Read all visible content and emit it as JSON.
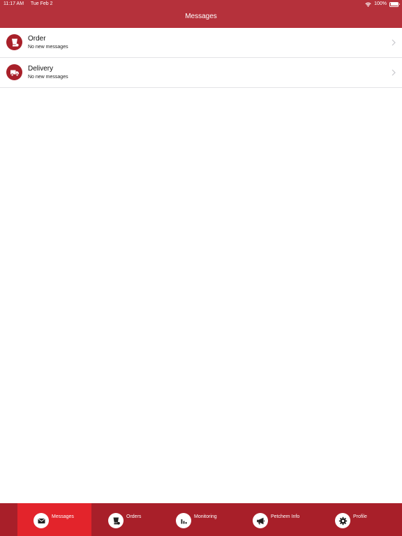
{
  "status_bar": {
    "time": "11:17 AM",
    "date": "Tue Feb 2",
    "battery": "100%",
    "wifi_icon": "wifi-icon",
    "battery_icon": "battery-icon",
    "battery_level": 1.0
  },
  "header": {
    "title": "Messages"
  },
  "messages": [
    {
      "title": "Order",
      "subtitle": "No new messages",
      "icon": "order-icon"
    },
    {
      "title": "Delivery",
      "subtitle": "No new messages",
      "icon": "truck-icon"
    }
  ],
  "tabs": [
    {
      "label": "Messages",
      "icon": "envelope-icon",
      "active": true
    },
    {
      "label": "Orders",
      "icon": "order-icon",
      "active": false
    },
    {
      "label": "Monitoring",
      "icon": "bar-chart-icon",
      "active": false
    },
    {
      "label": "Petchem Info",
      "icon": "megaphone-icon",
      "active": false
    },
    {
      "label": "Profile",
      "icon": "gear-icon",
      "active": false
    }
  ],
  "colors": {
    "header_bg": "#b5313b",
    "tabbar_bg": "#a81f29",
    "active_tab_bg": "#e3242b",
    "icon_circle": "#a82029"
  }
}
